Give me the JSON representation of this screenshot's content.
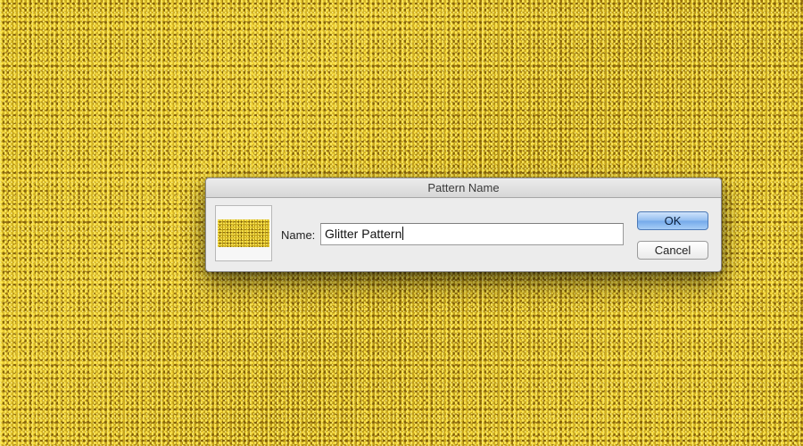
{
  "dialog": {
    "title": "Pattern Name",
    "name_label": "Name:",
    "name_value": "Glitter Pattern",
    "ok_label": "OK",
    "cancel_label": "Cancel"
  },
  "colors": {
    "canvas_gold": "#c9a91a",
    "ok_button_blue": "#92bdf0",
    "dialog_bg": "#ececec"
  }
}
